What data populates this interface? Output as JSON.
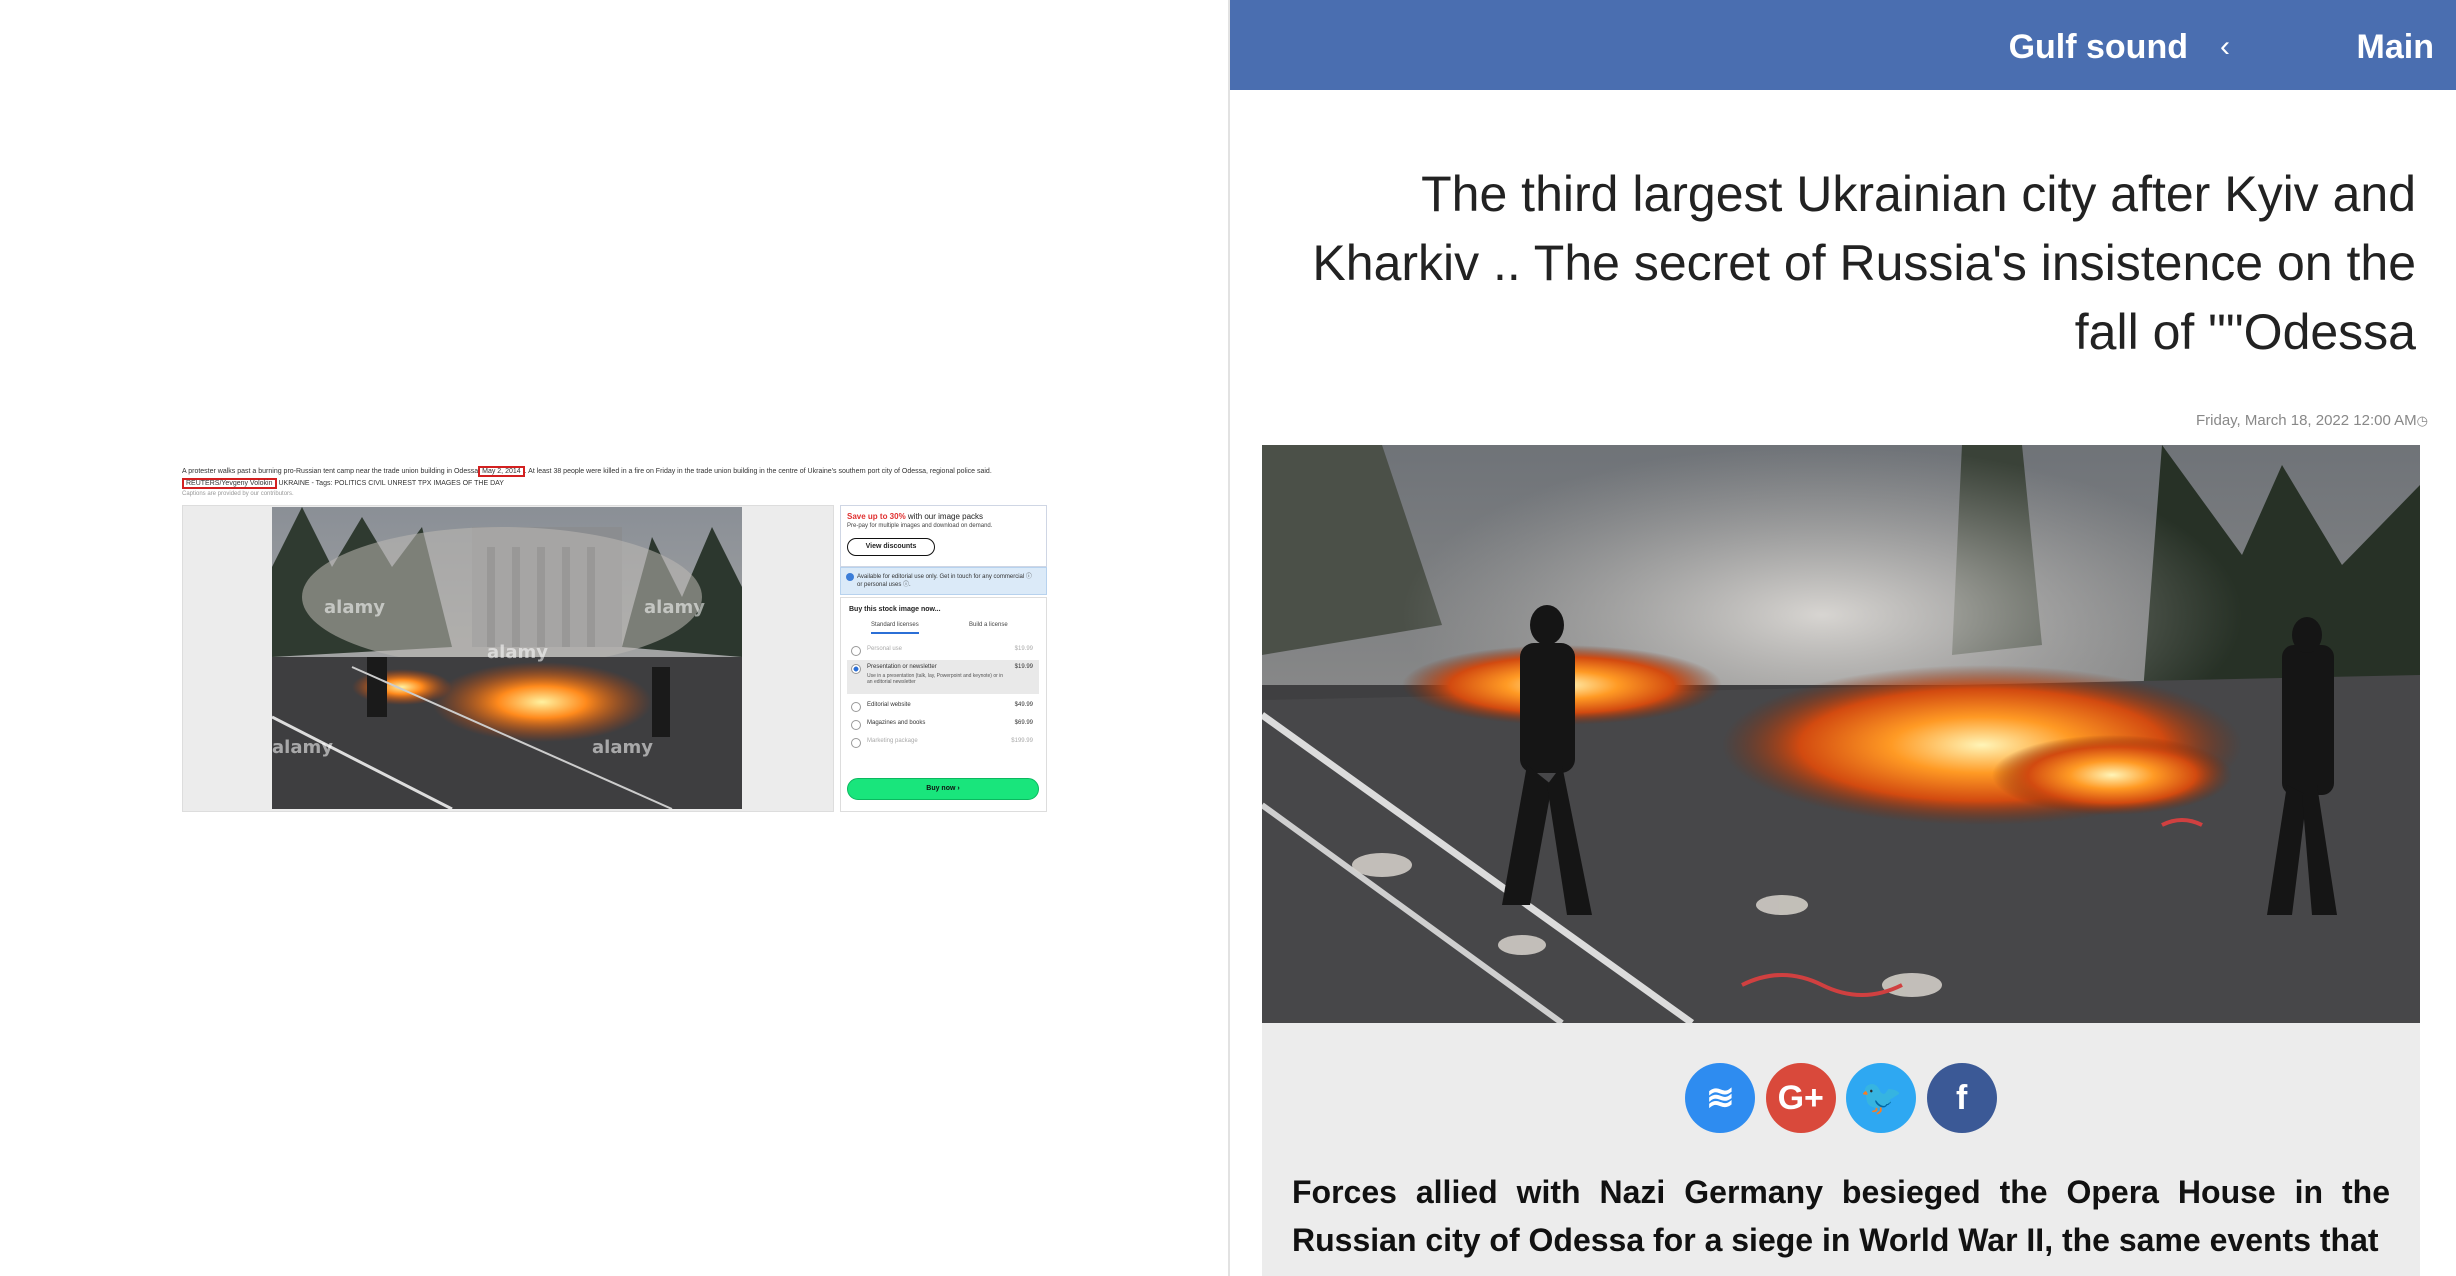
{
  "left_page": {
    "caption_part1": "A protester walks past a burning pro-Russian tent camp near the trade union building in Odessa",
    "caption_date": "May 2, 2014",
    "caption_part2": ". At least 38 people were killed in a fire on Friday in the trade union building in the centre of Ukraine's southern port city of Odessa, regional police said.",
    "credit": "REUTERS/Yevgeny Volokin",
    "tags": "UKRAINE - Tags: POLITICS CIVIL UNREST TPX IMAGES OF THE DAY",
    "captions_note": "Captions are provided by our contributors.",
    "watermark": "alamy",
    "promo": {
      "title_highlight": "Save up to 30%",
      "title_rest": " with our image packs",
      "subtitle": "Pre-pay for multiple images and download on demand.",
      "button": "View discounts"
    },
    "info": "Available for editorial use only. Get in touch for any commercial ⓘ or personal uses ⓘ.",
    "buy": {
      "title": "Buy this stock image now...",
      "tabs": [
        "Standard licenses",
        "Build a license"
      ],
      "options": [
        {
          "label": "Personal use",
          "price": "$19.99"
        },
        {
          "label": "Presentation or newsletter",
          "price": "$19.99",
          "desc": "Use in a presentation (talk, lay, Powerpoint and keynote) or in an editorial newsletter"
        },
        {
          "label": "Editorial website",
          "price": "$49.99"
        },
        {
          "label": "Magazines and books",
          "price": "$69.99"
        },
        {
          "label": "Marketing package",
          "price": "$199.99"
        }
      ],
      "button": "Buy now ›"
    }
  },
  "right_page": {
    "brand": "Gulf sound",
    "nav_separator": "‹",
    "nav_main": "Main",
    "title": "The third largest Ukrainian city after Kyiv and Kharkiv .. The secret of Russia's insistence on the fall of \"\"Odessa",
    "date": "Friday, March 18, 2022 12:00 AM",
    "share": [
      {
        "name": "messenger-icon",
        "glyph": "≋"
      },
      {
        "name": "google-plus-icon",
        "glyph": "G+"
      },
      {
        "name": "twitter-icon",
        "glyph": "🐦"
      },
      {
        "name": "facebook-icon",
        "glyph": "f"
      }
    ],
    "body": "Forces allied with Nazi Germany besieged the Opera House in the Russian city of Odessa for a siege in World War II, the same events that"
  },
  "colors": {
    "header_blue": "#4a6eb0",
    "buy_green": "#19e57c",
    "highlight_red": "#d32020",
    "share_grey": "#ececec"
  }
}
